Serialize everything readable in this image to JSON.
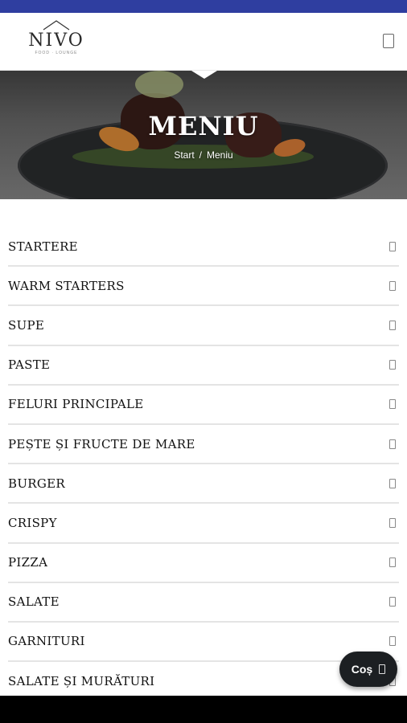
{
  "header": {
    "logo_text": "NIVO",
    "logo_sub": "FOOD · LOUNGE",
    "menu_icon": "hamburger-icon"
  },
  "hero": {
    "title": "MENIU",
    "breadcrumb": {
      "home": "Start",
      "separator": "/",
      "current": "Meniu"
    }
  },
  "categories": [
    {
      "label": "STARTERE"
    },
    {
      "label": "WARM STARTERS"
    },
    {
      "label": "SUPE"
    },
    {
      "label": "PASTE"
    },
    {
      "label": "FELURI PRINCIPALE"
    },
    {
      "label": "PEȘTE ȘI FRUCTE DE MARE"
    },
    {
      "label": "BURGER"
    },
    {
      "label": "CRISPY"
    },
    {
      "label": "PIZZA"
    },
    {
      "label": "SALATE"
    },
    {
      "label": "GARNITURI"
    },
    {
      "label": "SALATE ȘI MURĂTURI"
    }
  ],
  "cart": {
    "label": "Coș",
    "icon": "cart-icon"
  },
  "colors": {
    "status_bar": "#2f3ea0",
    "cart_bg": "#1c1f22"
  }
}
